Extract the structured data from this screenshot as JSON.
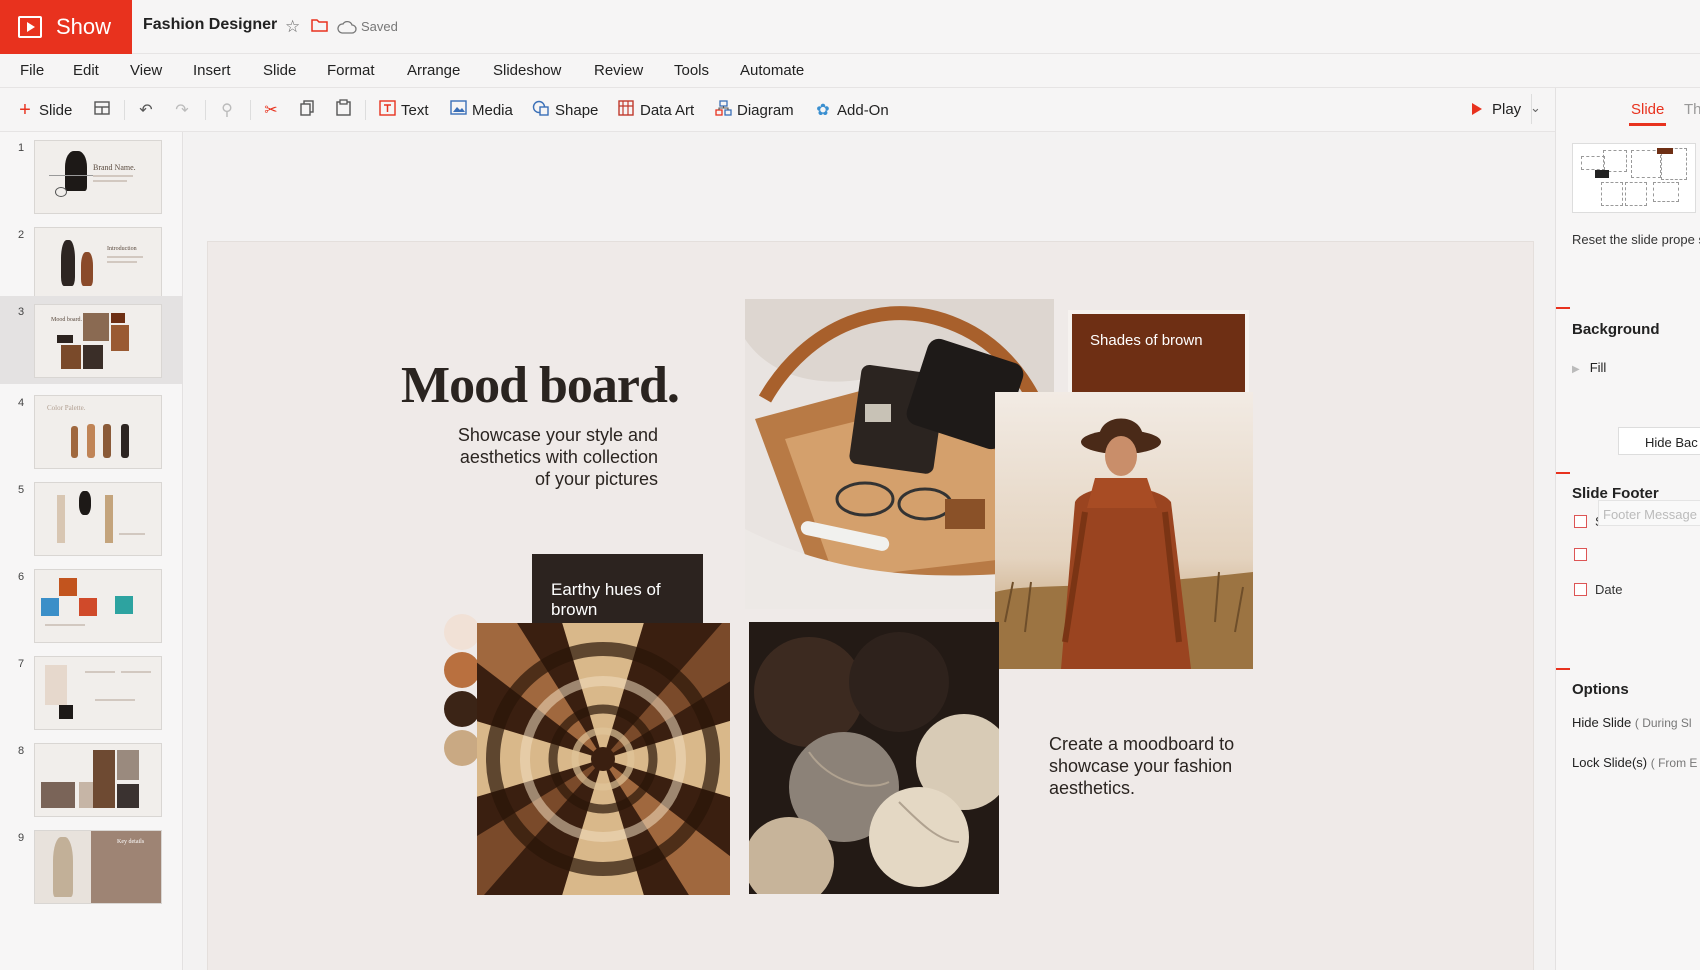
{
  "app": {
    "name": "Show",
    "doc_title": "Fashion Designer",
    "saved": "Saved"
  },
  "menu": [
    "File",
    "Edit",
    "View",
    "Insert",
    "Slide",
    "Format",
    "Arrange",
    "Slideshow",
    "Review",
    "Tools",
    "Automate"
  ],
  "toolbar": {
    "slide": "Slide",
    "text": "Text",
    "media": "Media",
    "shape": "Shape",
    "data_art": "Data Art",
    "diagram": "Diagram",
    "addon": "Add-On",
    "play": "Play"
  },
  "thumbnails": {
    "numbers": [
      "1",
      "2",
      "3",
      "4",
      "5",
      "6",
      "7",
      "8",
      "9"
    ],
    "labels": [
      "Brand Name.",
      "Introduction",
      "Mood board.",
      "Color Palette.",
      "Key details"
    ],
    "active_index": 3
  },
  "slide": {
    "title": "Mood board.",
    "subtitle": "Showcase your style and aesthetics with collection of your pictures",
    "dark_box": "Earthy hues of brown",
    "brown_box": "Shades of brown",
    "caption": "Create a moodboard to showcase your fashion aesthetics.",
    "swatches": [
      "#f1e1d6",
      "#b9703f",
      "#3b2416",
      "#c9a983"
    ]
  },
  "props": {
    "tab_slide": "Slide",
    "tab_theme": "Th",
    "reset_text": "Reset the slide prope slide.",
    "background": "Background",
    "fill": "Fill",
    "hide_bg": "Hide Bac",
    "slide_footer": "Slide Footer",
    "show_slide_number": "Show Slide Numb",
    "footer_message": "Footer Message",
    "date": "Date",
    "options": "Options",
    "hide_slide": "Hide Slide",
    "hide_slide_note": "( During Sl",
    "lock_slides": "Lock Slide(s)",
    "lock_slides_note": "( From E"
  },
  "colors": {
    "accent": "#e8321e",
    "dark_brown": "#2c231f",
    "rust": "#6e2f14",
    "slide_bg": "#efeae8"
  },
  "icons": [
    "star-icon",
    "folder-icon",
    "cloud-icon",
    "plus-icon",
    "layout-icon",
    "undo-icon",
    "redo-icon",
    "paint-format-icon",
    "scissors-icon",
    "copy-icon",
    "paste-icon",
    "text-box-icon",
    "media-icon",
    "shape-icon",
    "data-art-icon",
    "diagram-icon",
    "puzzle-icon",
    "play-icon",
    "chevron-down-icon",
    "caret-right-icon"
  ]
}
